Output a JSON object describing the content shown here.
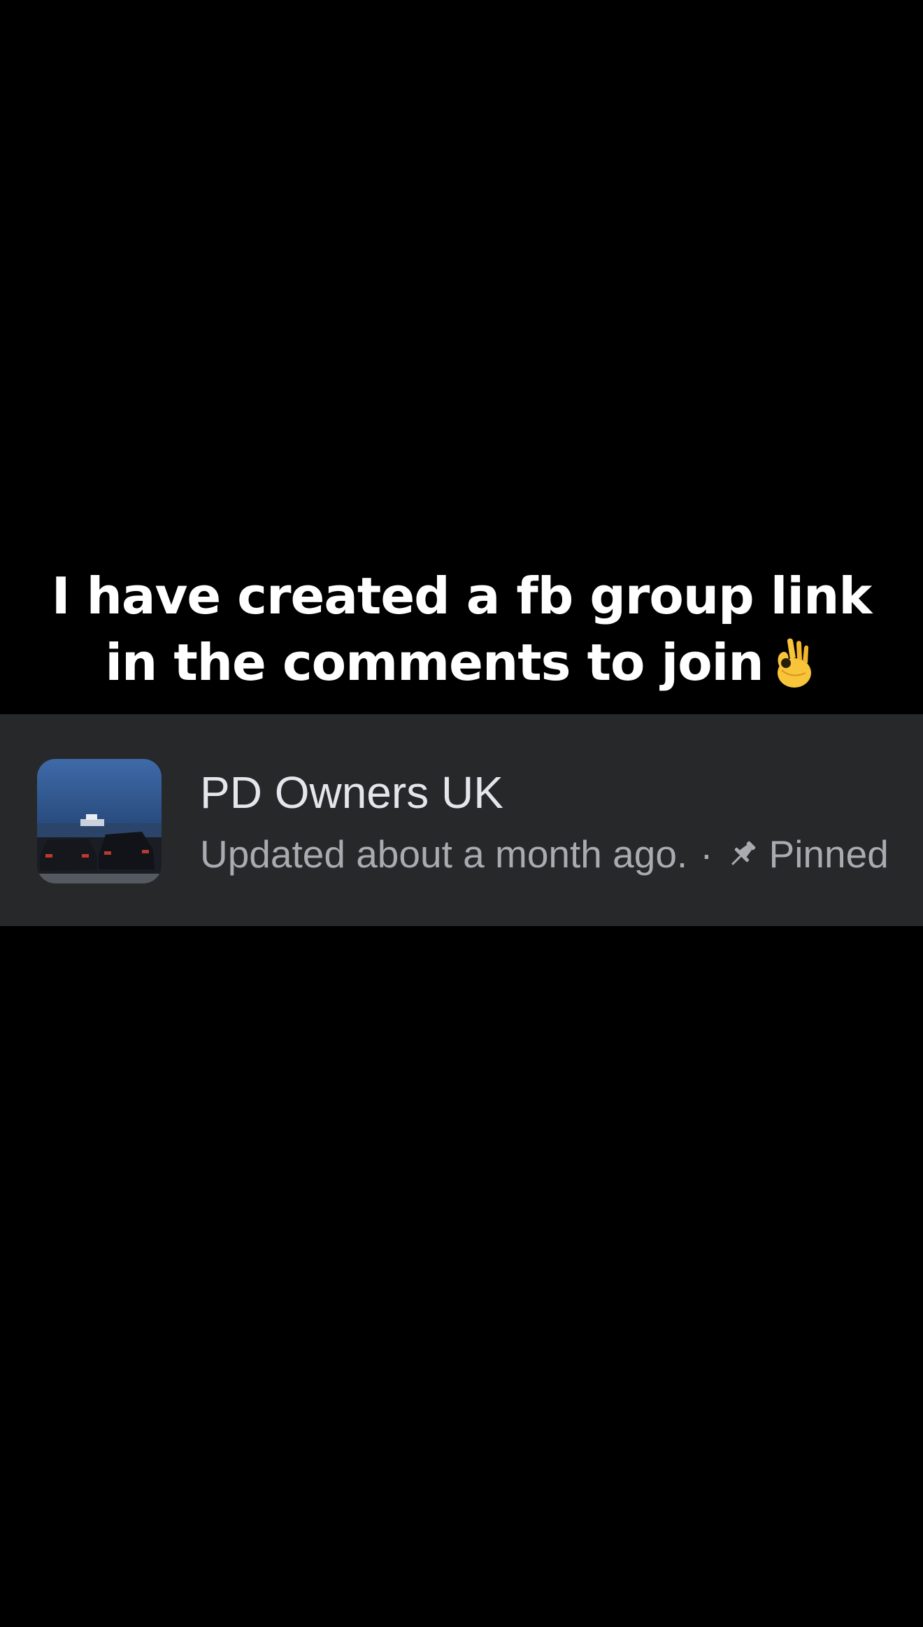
{
  "caption": {
    "line1": "I have created a fb group link",
    "line2": "in the comments to join",
    "emoji": "ok-hand-emoji"
  },
  "group_card": {
    "name": "PD Owners UK",
    "updated": "Updated about a month ago.",
    "separator": "·",
    "pinned_label": "Pinned",
    "pin_icon": "pin-icon",
    "avatar": "group-avatar-photo"
  },
  "colors": {
    "background": "#000000",
    "card_background": "#27282a",
    "caption_text": "#ffffff",
    "name_text": "#e4e6eb",
    "meta_text": "#a8abb0"
  }
}
